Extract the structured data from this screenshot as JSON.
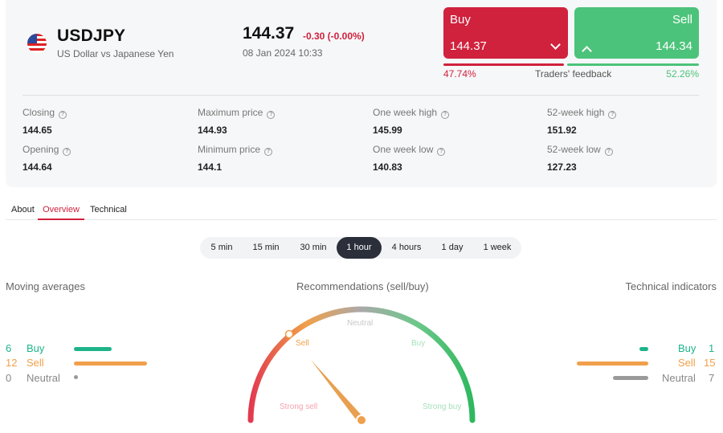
{
  "instrument": {
    "symbol": "USDJPY",
    "name": "US Dollar vs Japanese Yen",
    "price": "144.37",
    "change": "-0.30 (-0.00%)",
    "timestamp": "08 Jan 2024 10:33"
  },
  "trade": {
    "buy_label": "Buy",
    "buy_price": "144.37",
    "sell_label": "Sell",
    "sell_price": "144.34",
    "feedback_buy": "47.74%",
    "feedback_label": "Traders' feedback",
    "feedback_sell": "52.26%",
    "feedback_buy_fraction": 0.4774
  },
  "stats": [
    {
      "label": "Closing",
      "value": "144.65"
    },
    {
      "label": "Maximum price",
      "value": "144.93"
    },
    {
      "label": "One week high",
      "value": "145.99"
    },
    {
      "label": "52-week high",
      "value": "151.92"
    },
    {
      "label": "Opening",
      "value": "144.64"
    },
    {
      "label": "Minimum price",
      "value": "144.1"
    },
    {
      "label": "One week low",
      "value": "140.83"
    },
    {
      "label": "52-week low",
      "value": "127.23"
    }
  ],
  "tabs": [
    {
      "label": "About"
    },
    {
      "label": "Overview",
      "active": true
    },
    {
      "label": "Technical"
    }
  ],
  "periods": [
    {
      "label": "5 min"
    },
    {
      "label": "15 min"
    },
    {
      "label": "30 min"
    },
    {
      "label": "1 hour",
      "active": true
    },
    {
      "label": "4 hours"
    },
    {
      "label": "1 day"
    },
    {
      "label": "1 week"
    }
  ],
  "moving_averages": {
    "title": "Moving averages",
    "rows": [
      {
        "count": "6",
        "label": "Buy",
        "color": "#1eb48a"
      },
      {
        "count": "12",
        "label": "Sell",
        "color": "#f0a04b"
      },
      {
        "count": "0",
        "label": "Neutral",
        "color": "#9a9a9a"
      }
    ]
  },
  "recommendations": {
    "title": "Recommendations (sell/buy)",
    "labels": {
      "strong_sell": "Strong sell",
      "sell": "Sell",
      "neutral": "Neutral",
      "buy": "Buy",
      "strong_buy": "Strong buy"
    },
    "current": "Sell"
  },
  "technical_indicators": {
    "title": "Technical indicators",
    "rows": [
      {
        "count": "1",
        "label": "Buy",
        "color": "#1eb48a"
      },
      {
        "count": "15",
        "label": "Sell",
        "color": "#f0a04b"
      },
      {
        "count": "7",
        "label": "Neutral",
        "color": "#9a9a9a"
      }
    ]
  },
  "colors": {
    "accent_red": "#d0213d",
    "accent_green": "#4cc37a",
    "dark": "#2a2f3a"
  },
  "icons": {
    "flag": "us-flag-icon",
    "info": "info-icon",
    "buy_chevron": "chevron-down-icon",
    "sell_chevron": "chevron-up-icon"
  }
}
